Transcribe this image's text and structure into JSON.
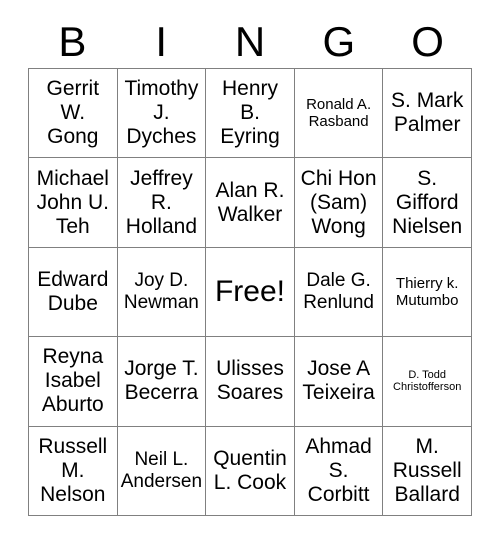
{
  "card": {
    "title": "BINGO",
    "headers": [
      "B",
      "I",
      "N",
      "G",
      "O"
    ],
    "free_space_label": "Free!",
    "border_color": "#808080",
    "text_color": "#000000",
    "background_color": "#ffffff",
    "rows": [
      [
        {
          "name": "Gerrit W. Gong",
          "size": "lg"
        },
        {
          "name": "Timothy J. Dyches",
          "size": "lg"
        },
        {
          "name": "Henry B. Eyring",
          "size": "lg"
        },
        {
          "name": "Ronald A. Rasband",
          "size": "sm"
        },
        {
          "name": "S. Mark Palmer",
          "size": "lg"
        }
      ],
      [
        {
          "name": "Michael John U. Teh",
          "size": "lg"
        },
        {
          "name": "Jeffrey R. Holland",
          "size": "lg"
        },
        {
          "name": "Alan R. Walker",
          "size": "lg"
        },
        {
          "name": "Chi Hon (Sam) Wong",
          "size": "lg"
        },
        {
          "name": "S. Gifford Nielsen",
          "size": "lg"
        }
      ],
      [
        {
          "name": "Edward Dube",
          "size": "lg"
        },
        {
          "name": "Joy D. Newman",
          "size": "md"
        },
        {
          "name": "Free!",
          "size": "free"
        },
        {
          "name": "Dale G. Renlund",
          "size": "md"
        },
        {
          "name": "Thierry k. Mutumbo",
          "size": "sm"
        }
      ],
      [
        {
          "name": "Reyna Isabel Aburto",
          "size": "lg"
        },
        {
          "name": "Jorge T. Becerra",
          "size": "lg"
        },
        {
          "name": "Ulisses Soares",
          "size": "lg"
        },
        {
          "name": "Jose A Teixeira",
          "size": "lg"
        },
        {
          "name": "D. Todd Christofferson",
          "size": "xs"
        }
      ],
      [
        {
          "name": "Russell M. Nelson",
          "size": "lg"
        },
        {
          "name": "Neil L. Andersen",
          "size": "md"
        },
        {
          "name": "Quentin L. Cook",
          "size": "lg"
        },
        {
          "name": "Ahmad S. Corbitt",
          "size": "lg"
        },
        {
          "name": "M. Russell Ballard",
          "size": "lg"
        }
      ]
    ]
  }
}
